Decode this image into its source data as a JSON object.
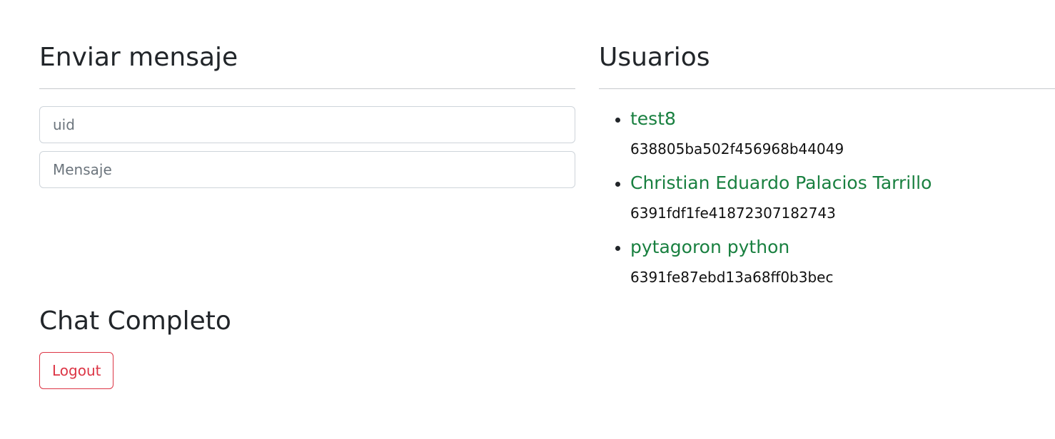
{
  "send": {
    "title": "Enviar mensaje",
    "uid_placeholder": "uid",
    "message_placeholder": "Mensaje"
  },
  "chat": {
    "title": "Chat Completo",
    "logout_label": "Logout"
  },
  "users": {
    "title": "Usuarios",
    "items": [
      {
        "name": "test8",
        "id": "638805ba502f456968b44049"
      },
      {
        "name": "Christian Eduardo Palacios Tarrillo",
        "id": "6391fdf1fe41872307182743"
      },
      {
        "name": "pytagoron python",
        "id": "6391fe87ebd13a68ff0b3bec"
      }
    ]
  },
  "colors": {
    "user_name": "#198040",
    "danger": "#dc3545",
    "text": "#212529"
  }
}
